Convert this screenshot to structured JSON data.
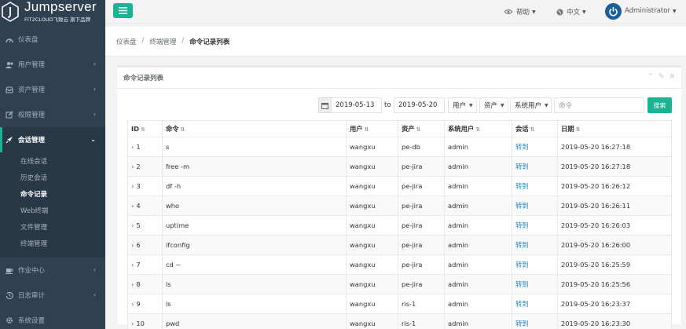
{
  "brand": {
    "name": "Jumpserver",
    "subtitle": "FIT2CLOUD飞致云 旗下品牌"
  },
  "sidebar": {
    "items": [
      {
        "label": "仪表盘",
        "icon": "dashboard-icon"
      },
      {
        "label": "用户管理",
        "icon": "users-icon"
      },
      {
        "label": "资产管理",
        "icon": "inbox-icon"
      },
      {
        "label": "权限管理",
        "icon": "edit-icon"
      },
      {
        "label": "会话管理",
        "icon": "rocket-icon"
      },
      {
        "label": "作业中心",
        "icon": "coffee-icon"
      },
      {
        "label": "日志审计",
        "icon": "history-icon"
      },
      {
        "label": "系统设置",
        "icon": "gear-icon"
      }
    ],
    "session_sub": [
      "在线会话",
      "历史会话",
      "命令记录",
      "Web终端",
      "文件管理",
      "终端管理"
    ]
  },
  "topbar": {
    "help": "帮助",
    "language": "中文",
    "user": "Administrator"
  },
  "breadcrumb": [
    "仪表盘",
    "终端管理",
    "命令记录列表"
  ],
  "panel": {
    "title": "命令记录列表"
  },
  "filters": {
    "date_from": "2019-05-13",
    "to_label": "to",
    "date_to": "2019-05-20",
    "user": "用户",
    "asset": "资产",
    "system_user": "系统用户",
    "command_placeholder": "命令",
    "search_label": "搜索"
  },
  "table": {
    "columns": [
      "ID",
      "命令",
      "用户",
      "资产",
      "系统用户",
      "会话",
      "日期"
    ],
    "rows": [
      {
        "id": "1",
        "command": "s",
        "user": "wangxu",
        "asset": "pe-db",
        "system_user": "admin",
        "session": "转到",
        "date": "2019-05-20 16:27:18"
      },
      {
        "id": "2",
        "command": "free -m",
        "user": "wangxu",
        "asset": "pe-jira",
        "system_user": "admin",
        "session": "转到",
        "date": "2019-05-20 16:27:18"
      },
      {
        "id": "3",
        "command": "df -h",
        "user": "wangxu",
        "asset": "pe-jira",
        "system_user": "admin",
        "session": "转到",
        "date": "2019-05-20 16:26:12"
      },
      {
        "id": "4",
        "command": "who",
        "user": "wangxu",
        "asset": "pe-jira",
        "system_user": "admin",
        "session": "转到",
        "date": "2019-05-20 16:26:11"
      },
      {
        "id": "5",
        "command": "uptime",
        "user": "wangxu",
        "asset": "pe-jira",
        "system_user": "admin",
        "session": "转到",
        "date": "2019-05-20 16:26:03"
      },
      {
        "id": "6",
        "command": "ifconfig",
        "user": "wangxu",
        "asset": "pe-jira",
        "system_user": "admin",
        "session": "转到",
        "date": "2019-05-20 16:26:00"
      },
      {
        "id": "7",
        "command": "cd ~",
        "user": "wangxu",
        "asset": "pe-jira",
        "system_user": "admin",
        "session": "转到",
        "date": "2019-05-20 16:25:59"
      },
      {
        "id": "8",
        "command": "ls",
        "user": "wangxu",
        "asset": "pe-jira",
        "system_user": "admin",
        "session": "转到",
        "date": "2019-05-20 16:25:56"
      },
      {
        "id": "9",
        "command": "ls",
        "user": "wangxu",
        "asset": "ris-1",
        "system_user": "admin",
        "session": "转到",
        "date": "2019-05-20 16:23:37"
      },
      {
        "id": "10",
        "command": "pwd",
        "user": "wangxu",
        "asset": "ris-1",
        "system_user": "admin",
        "session": "转到",
        "date": "2019-05-20 16:23:30"
      }
    ]
  },
  "colors": {
    "accent": "#1ab394",
    "sidebar": "#2f4050",
    "link": "#1c84c6"
  }
}
